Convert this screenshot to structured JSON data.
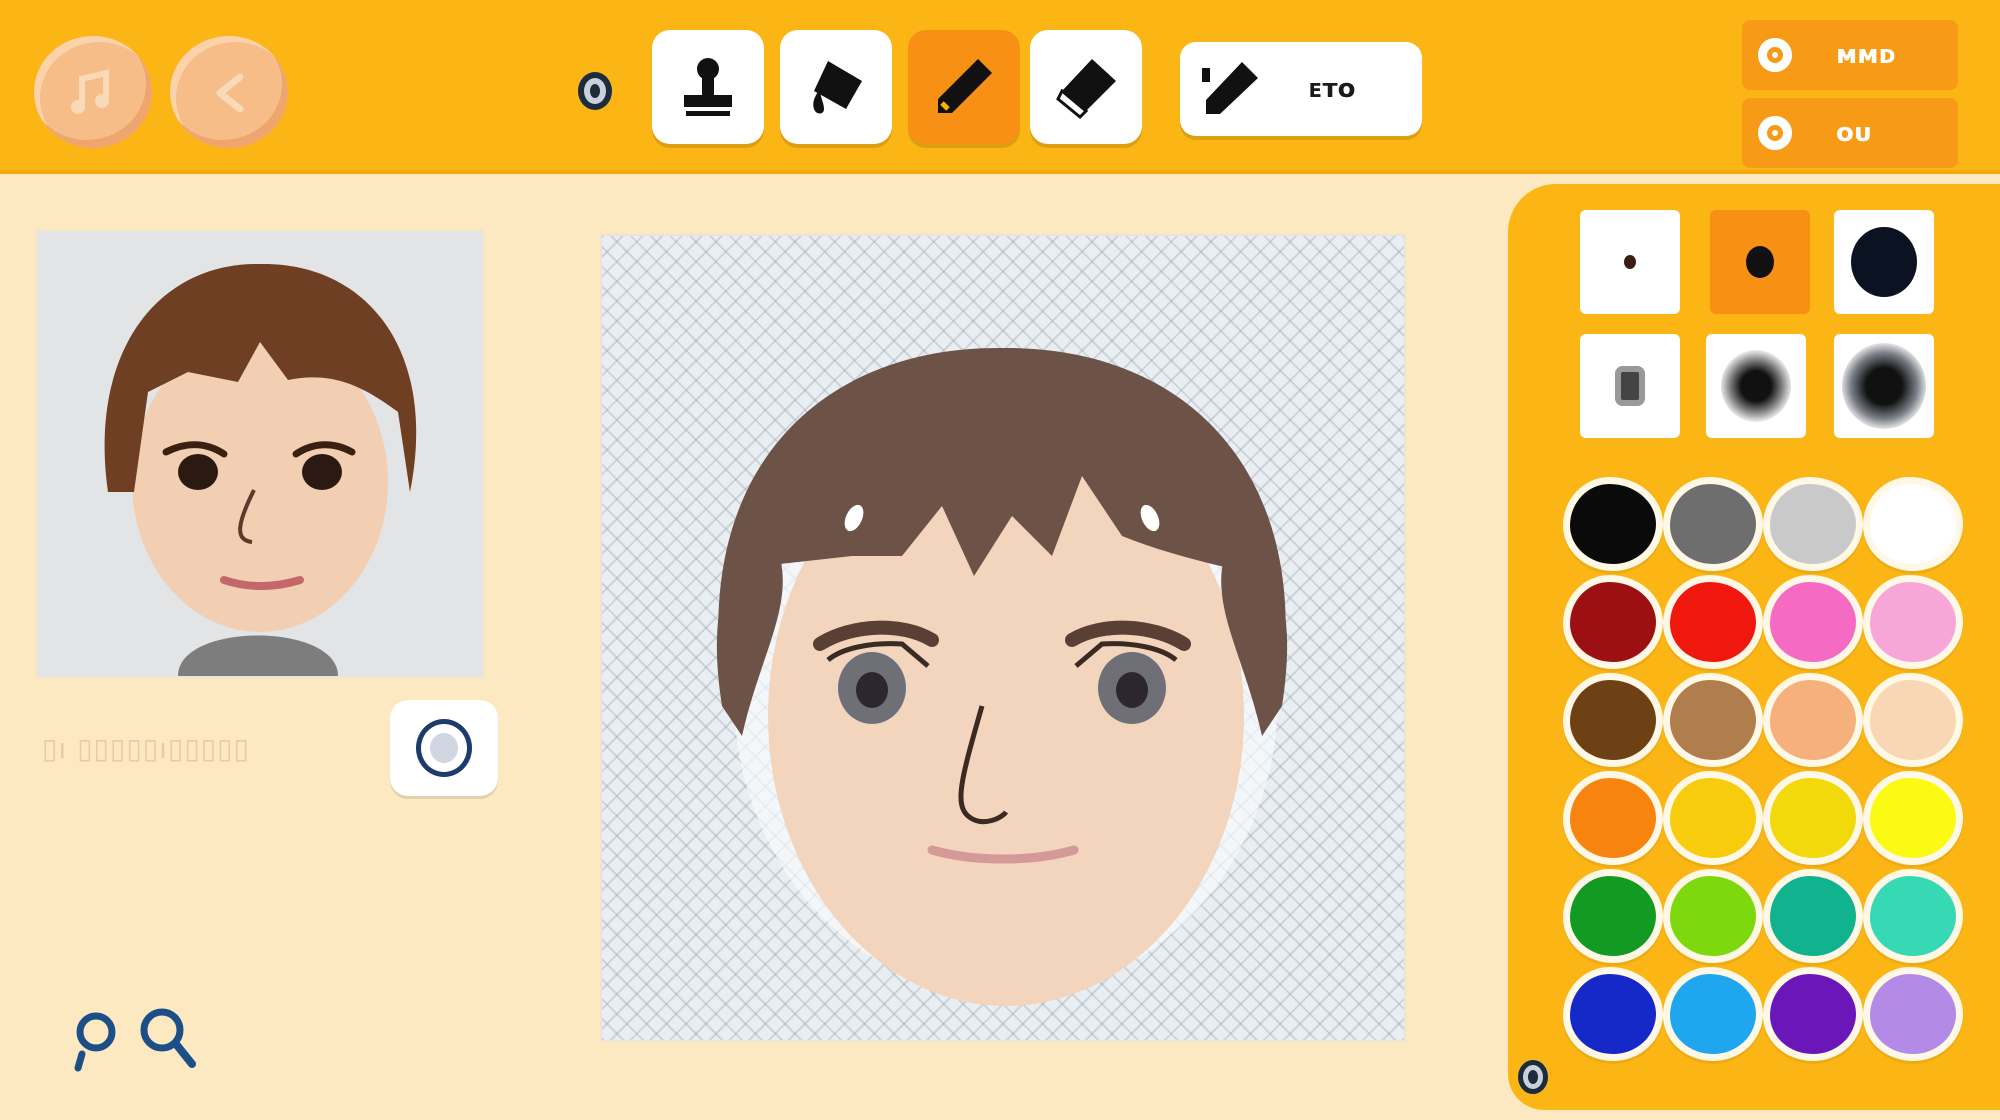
{
  "toolbar": {
    "left_buttons": [
      {
        "icon": "music-note-icon"
      },
      {
        "icon": "back-arrow-icon"
      }
    ],
    "tools": [
      {
        "icon": "stamp-icon",
        "active": false
      },
      {
        "icon": "paint-bucket-icon",
        "active": false
      },
      {
        "icon": "pencil-icon",
        "active": true
      },
      {
        "icon": "eraser-icon",
        "active": false
      }
    ],
    "wide_tool": {
      "icon": "pen-icon",
      "label": "ᴇᴛᴏ"
    },
    "right_buttons": [
      {
        "label": "ᴍᴍᴅ"
      },
      {
        "label": "ᴏᴜ"
      }
    ]
  },
  "preview": {
    "caption": "▯ı ▯▯▯▯▯ı▯▯▯▯▯"
  },
  "brush_sizes": [
    {
      "size": "small",
      "active": false
    },
    {
      "size": "medium",
      "active": true
    },
    {
      "size": "large",
      "active": false
    },
    {
      "size": "square",
      "active": false
    },
    {
      "size": "soft-medium",
      "active": false
    },
    {
      "size": "soft-large",
      "active": false
    }
  ],
  "colors": [
    "#0a0a0a",
    "#6e6e6e",
    "#c9c9c9",
    "#ffffff",
    "#9c0f12",
    "#f0170f",
    "#f56ac2",
    "#f7a6d9",
    "#6e4115",
    "#b07d4c",
    "#f6b07c",
    "#f8d8b4",
    "#f6840f",
    "#f6cc0c",
    "#f1d90b",
    "#fafa12",
    "#129a22",
    "#7ed80e",
    "#10b38e",
    "#37d9b5",
    "#1528c8",
    "#1ea6ee",
    "#6a16b8",
    "#b38ae6"
  ]
}
